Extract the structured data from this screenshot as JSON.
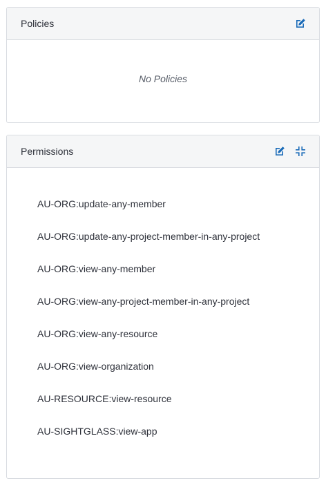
{
  "policies": {
    "title": "Policies",
    "empty_text": "No Policies",
    "icons": {
      "edit": "edit-icon"
    }
  },
  "permissions": {
    "title": "Permissions",
    "icons": {
      "edit": "edit-icon",
      "collapse": "collapse-icon"
    },
    "items": [
      "AU-ORG:update-any-member",
      "AU-ORG:update-any-project-member-in-any-project",
      "AU-ORG:view-any-member",
      "AU-ORG:view-any-project-member-in-any-project",
      "AU-ORG:view-any-resource",
      "AU-ORG:view-organization",
      "AU-RESOURCE:view-resource",
      "AU-SIGHTGLASS:view-app"
    ]
  },
  "colors": {
    "accent": "#1a6bb8",
    "header_bg": "#f5f6f7",
    "border": "#d9dce1"
  }
}
